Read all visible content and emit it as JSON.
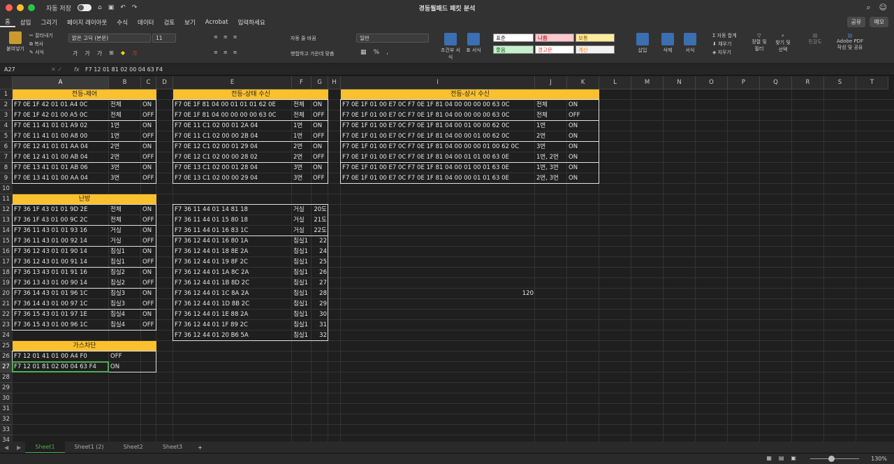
{
  "app": {
    "title": "경동월패드 패킷 분석",
    "autosave": "자동 저장",
    "autosave_state": "꺼짐"
  },
  "menu": {
    "items": [
      "홈",
      "삽입",
      "그리기",
      "페이지 레이아웃",
      "수식",
      "데이터",
      "검토",
      "보기",
      "Acrobat"
    ],
    "tell": "입력하세요",
    "share": "공유",
    "memo": "메모"
  },
  "ribbon": {
    "paste": "붙여넣기",
    "cut": "잘라내기",
    "copy": "복사",
    "format": "서식",
    "font_name": "맑은 고딕 (본문)",
    "font_size": "11",
    "wrap": "자동 줄 바꿈",
    "merge": "병합하고 가운데 맞춤",
    "number_format": "일반",
    "cond_format": "조건부 서식",
    "table_format": "표 서식",
    "styles": {
      "normal": "표준",
      "bad": "나쁨",
      "neutral": "보통",
      "good": "좋음",
      "warning": "경고문",
      "calc": "계산"
    },
    "insert": "삽입",
    "delete": "삭제",
    "format2": "서식",
    "autosum": "자동 합계",
    "fill": "채우기",
    "clear": "지우기",
    "sort": "정렬 및 필터",
    "find": "찾기 및 선택",
    "sensitivity": "민감도",
    "pdf": "Adobe PDF 작성 및 공유"
  },
  "formula": {
    "namebox": "A27",
    "fx": "fx",
    "value": "F7 12 01 81 02 00 04 63 F4"
  },
  "columns": [
    "A",
    "B",
    "C",
    "D",
    "E",
    "F",
    "G",
    "H",
    "I",
    "J",
    "K",
    "L",
    "M",
    "N",
    "O",
    "P",
    "Q",
    "R",
    "S",
    "T"
  ],
  "headers": {
    "control": "전등-제어",
    "status": "전등-상태 수신",
    "always": "전등-상시 수신",
    "heat": "난방",
    "gas": "가스차단"
  },
  "control": [
    [
      "F7 0E 1F 42 01 01 A4 0C",
      "전체",
      "ON"
    ],
    [
      "F7 0E 1F 42 01 00 A5 0C",
      "전체",
      "OFF"
    ],
    [
      "F7 0E 11 41 01 01 A9 02",
      "1번",
      "ON"
    ],
    [
      "F7 0E 11 41 01 00 A8 00",
      "1번",
      "OFF"
    ],
    [
      "F7 0E 12 41 01 01 AA 04",
      "2번",
      "ON"
    ],
    [
      "F7 0E 12 41 01 00 AB 04",
      "2번",
      "OFF"
    ],
    [
      "F7 0E 13 41 01 01 AB 06",
      "3번",
      "ON"
    ],
    [
      "F7 0E 13 41 01 00 AA 04",
      "3번",
      "OFF"
    ]
  ],
  "status": [
    [
      "F7 0E 1F 81 04 00 01 01 01 62 0E",
      "전체",
      "ON"
    ],
    [
      "F7 0E 1F 81 04 00 00 00 00 63 0C",
      "전체",
      "OFF"
    ],
    [
      "F7 0E 11 C1 02 00 01 2A 04",
      "1번",
      "ON"
    ],
    [
      "F7 0E 11 C1 02 00 00 2B 04",
      "1번",
      "OFF"
    ],
    [
      "F7 0E 12 C1 02 00 01 29 04",
      "2번",
      "ON"
    ],
    [
      "F7 0E 12 C1 02 00 00 28 02",
      "2번",
      "OFF"
    ],
    [
      "F7 0E 13 C1 02 00 01 28 04",
      "3번",
      "ON"
    ],
    [
      "F7 0E 13 C1 02 00 00 29 04",
      "3번",
      "OFF"
    ]
  ],
  "always": [
    [
      "F7 0E 1F 01 00 E7 0C F7 0E 1F 81 04 00 00 00 00 63 0C",
      "전체",
      "ON"
    ],
    [
      "F7 0E 1F 01 00 E7 0C F7 0E 1F 81 04 00 00 00 00 63 0C",
      "전체",
      "OFF"
    ],
    [
      "F7 0E 1F 01 00 E7 0C F7 0E 1F 81 04 00 01 00 00 62 0C",
      "1번",
      "ON"
    ],
    [
      "F7 0E 1F 01 00 E7 0C F7 0E 1F 81 04 00 00 01 00 62 0C",
      "2번",
      "ON"
    ],
    [
      "F7 0E 1F 01 00 E7 0C F7 0E 1F 81 04 00 00 00 01 00 62 0C",
      "3번",
      "ON"
    ],
    [
      "F7 0E 1F 01 00 E7 0C F7 0E 1F 81 04 00 01 01 00 63 0E",
      "1번, 2번",
      "ON"
    ],
    [
      "F7 0E 1F 01 00 E7 0C F7 0E 1F 81 04 00 01 00 01 63 0E",
      "1번, 3번",
      "ON"
    ],
    [
      "F7 0E 1F 01 00 E7 0C F7 0E 1F 81 04 00 00 01 01 63 0E",
      "2번, 3번",
      "ON"
    ]
  ],
  "heat": [
    [
      "F7 36 1F 43 01 01 9D 2E",
      "전체",
      "ON"
    ],
    [
      "F7 36 1F 43 01 00 9C 2C",
      "전체",
      "OFF"
    ],
    [
      "F7 36 11 43 01 01 93 16",
      "거실",
      "ON"
    ],
    [
      "F7 36 11 43 01 00 92 14",
      "거실",
      "OFF"
    ],
    [
      "F7 36 12 43 01 01 90 14",
      "침실1",
      "ON"
    ],
    [
      "F7 36 12 43 01 00 91 14",
      "침실1",
      "OFF"
    ],
    [
      "F7 36 13 43 01 01 91 16",
      "침실2",
      "ON"
    ],
    [
      "F7 36 13 43 01 00 90 14",
      "침실2",
      "OFF"
    ],
    [
      "F7 36 14 43 01 01 96 1C",
      "침실3",
      "ON"
    ],
    [
      "F7 36 14 43 01 00 97 1C",
      "침실3",
      "OFF"
    ],
    [
      "F7 36 15 43 01 01 97 1E",
      "침실4",
      "ON"
    ],
    [
      "F7 36 15 43 01 00 96 1C",
      "침실4",
      "OFF"
    ]
  ],
  "temp": [
    [
      "F7 36 11 44 01 14 81 18",
      "거실",
      "20도"
    ],
    [
      "F7 36 11 44 01 15 80 18",
      "거실",
      "21도"
    ],
    [
      "F7 36 11 44 01 16 83 1C",
      "거실",
      "22도"
    ],
    [
      "F7 36 12 44 01 16 80 1A",
      "침실1",
      "22"
    ],
    [
      "F7 36 12 44 01 18 8E 2A",
      "침실1",
      "24"
    ],
    [
      "F7 36 12 44 01 19 8F 2C",
      "침실1",
      "25"
    ],
    [
      "F7 36 12 44 01 1A 8C 2A",
      "침실1",
      "26"
    ],
    [
      "F7 36 12 44 01 1B 8D 2C",
      "침실1",
      "27"
    ],
    [
      "F7 36 12 44 01 1C 8A 2A",
      "침실1",
      "28"
    ],
    [
      "F7 36 12 44 01 1D 8B 2C",
      "침실1",
      "29"
    ],
    [
      "F7 36 12 44 01 1E 88 2A",
      "침실1",
      "30"
    ],
    [
      "F7 36 12 44 01 1F 89 2C",
      "침실1",
      "31"
    ],
    [
      "F7 36 12 44 01 20 B6 5A",
      "침실1",
      "32"
    ]
  ],
  "gas": [
    [
      "F7 12 01 41 01 00 A4 F0",
      "OFF"
    ],
    [
      "F7 12 01 81 02 00 04 63 F4",
      "ON"
    ]
  ],
  "loose": {
    "i20": "120"
  },
  "sheets": [
    "Sheet1",
    "Sheet1 (2)",
    "Sheet2",
    "Sheet3"
  ],
  "status_bar": {
    "zoom": "130%"
  }
}
